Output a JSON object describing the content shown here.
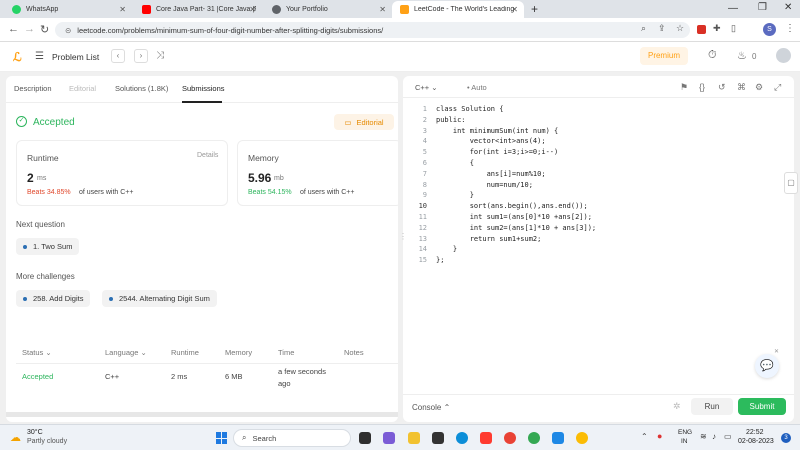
{
  "browser": {
    "tabs": [
      {
        "label": "WhatsApp",
        "color": "#25d366"
      },
      {
        "label": "Core Java Part- 31 |Core Java |F",
        "color": "#ff0000"
      },
      {
        "label": "Your Portfolio",
        "color": "#5f6368"
      },
      {
        "label": "LeetCode - The World's Leading",
        "color": "#ffa116"
      }
    ],
    "new_tab": "+",
    "url": "leetcode.com/problems/minimum-sum-of-four-digit-number-after-splitting-digits/submissions/",
    "profile_letter": "S"
  },
  "header": {
    "problem_list": "Problem List",
    "premium": "Premium",
    "streak_count": "0"
  },
  "left": {
    "tabs": [
      "Description",
      "Editorial",
      "Solutions (1.8K)",
      "Submissions"
    ],
    "status": "Accepted",
    "editorial_button": "Editorial",
    "runtime": {
      "label": "Runtime",
      "details": "Details",
      "value": "2",
      "unit": "ms",
      "beats": "Beats 34.85%",
      "beats_suffix": "of users with C++"
    },
    "memory": {
      "label": "Memory",
      "value": "5.96",
      "unit": "mb",
      "beats": "Beats 54.15%",
      "beats_suffix": "of users with C++"
    },
    "next_question_label": "Next question",
    "next_question": "1. Two Sum",
    "more_challenges_label": "More challenges",
    "challenges": [
      "258. Add Digits",
      "2544. Alternating Digit Sum"
    ],
    "table": {
      "headers": [
        "Status",
        "Language",
        "Runtime",
        "Memory",
        "Time",
        "Notes"
      ],
      "row": [
        "Accepted",
        "C++",
        "2 ms",
        "6 MB",
        "a few seconds ago",
        ""
      ]
    }
  },
  "editor": {
    "language": "C++",
    "mode": "Auto",
    "lines": [
      "class Solution {",
      "public:",
      "    int minimumSum(int num) {",
      "        vector<int>ans(4);",
      "        for(int i=3;i>=0;i--)",
      "        {",
      "            ans[i]=num%10;",
      "            num=num/10;",
      "        }",
      "        sort(ans.begin(),ans.end());",
      "        int sum1=(ans[0]*10 +ans[2]);",
      "        int sum2=(ans[1]*10 + ans[3]);",
      "        return sum1+sum2;",
      "    }",
      "};"
    ],
    "console": "Console",
    "run": "Run",
    "submit": "Submit"
  },
  "taskbar": {
    "temperature": "30°C",
    "weather": "Partly cloudy",
    "search": "Search",
    "lang": "ENG",
    "region": "IN",
    "time": "22:52",
    "date": "02-08-2023",
    "notification_count": "3"
  },
  "colors": {
    "accent_green": "#2cbb5d",
    "accepted_green": "#2db55d",
    "beats_red": "#e0482c",
    "premium_orange": "#ffa116"
  }
}
